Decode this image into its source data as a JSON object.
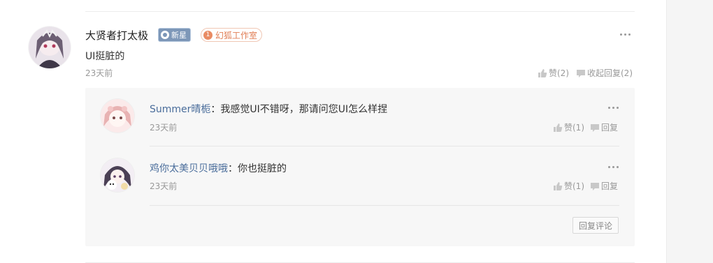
{
  "comment": {
    "username": "大贤者打太极",
    "level_badge": "新星",
    "studio_badge": {
      "number": "1",
      "label": "幻狐工作室"
    },
    "text": "UI挺脏的",
    "time": "23天前",
    "like_label": "赞(2)",
    "collapse_label": "收起回复(2)"
  },
  "replies": [
    {
      "username": "Summer晴栀",
      "colon": "：",
      "text": "我感觉UI不错呀，那请问您UI怎么样捏",
      "time": "23天前",
      "like_label": "赞(1)",
      "reply_label": "回复"
    },
    {
      "username": "鸡你太美贝贝哦哦",
      "colon": "：",
      "text": "你也挺脏的",
      "time": "23天前",
      "like_label": "赞(1)",
      "reply_label": "回复"
    }
  ],
  "reply_comment_button": "回复评论",
  "icons": {
    "like": "thumbs-up-icon",
    "reply": "comment-icon",
    "more": "more-dots-icon"
  }
}
